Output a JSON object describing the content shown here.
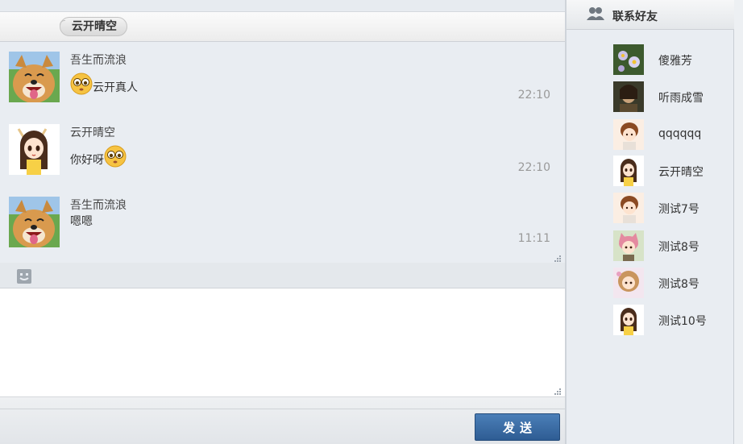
{
  "chat": {
    "title": "云开晴空",
    "messages": [
      {
        "sender": "吾生而流浪",
        "text": "云开真人",
        "emoji_before": true,
        "emoji_after": false,
        "time": "22:10",
        "avatar": "dog-avatar"
      },
      {
        "sender": "云开晴空",
        "text": "你好呀",
        "emoji_before": false,
        "emoji_after": true,
        "time": "22:10",
        "avatar": "anime-girl-avatar"
      },
      {
        "sender": "吾生而流浪",
        "text": "嗯嗯",
        "emoji_before": false,
        "emoji_after": false,
        "time": "11:11",
        "avatar": "dog-avatar"
      }
    ],
    "input_value": "",
    "send_label": "发送"
  },
  "contacts": {
    "title": "联系好友",
    "items": [
      {
        "name": "傻雅芳",
        "avatar": "flower-avatar"
      },
      {
        "name": "听雨成雪",
        "avatar": "warrior-avatar"
      },
      {
        "name": "qqqqqq",
        "avatar": "brown-hair-avatar"
      },
      {
        "name": "云开晴空",
        "avatar": "anime-girl-avatar"
      },
      {
        "name": "测试7号",
        "avatar": "brown-hair-avatar"
      },
      {
        "name": "测试8号",
        "avatar": "pink-cat-avatar"
      },
      {
        "name": "测试8号",
        "avatar": "curly-girl-avatar"
      },
      {
        "name": "测试10号",
        "avatar": "anime-girl-avatar"
      }
    ]
  },
  "colors": {
    "send_button": "#3a6ca5",
    "panel_bg": "#e9edf2",
    "timestamp": "#999999"
  }
}
